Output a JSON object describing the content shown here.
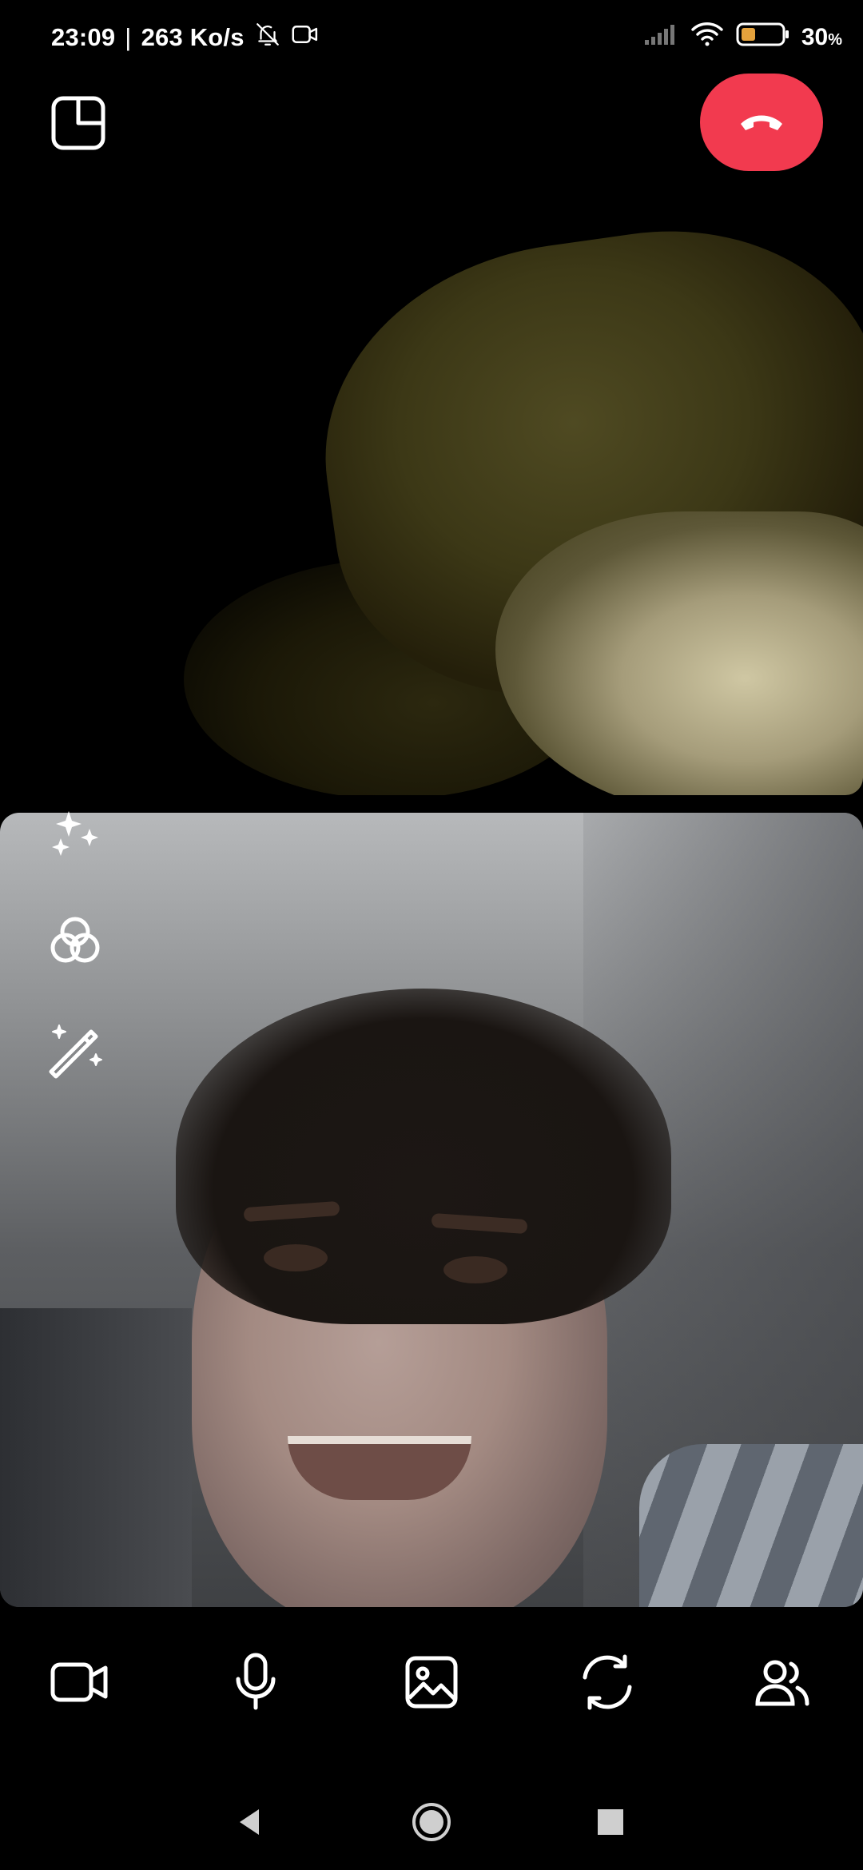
{
  "status_bar": {
    "time": "23:09",
    "separator": "|",
    "speed": "263 Ko/s",
    "battery_percent": "30",
    "battery_unit": "%",
    "icons": [
      "bell-off-icon",
      "video-camera-small-icon",
      "signal-icon",
      "wifi-icon",
      "battery-icon"
    ]
  },
  "call": {
    "top_controls": [
      "layout-icon",
      "end-call-icon"
    ],
    "end_call_color": "#f23a4f",
    "side_tools": [
      "sparkles-icon",
      "color-filter-icon",
      "magic-wand-icon"
    ],
    "bottom_controls": [
      "video-camera-icon",
      "microphone-icon",
      "gallery-icon",
      "switch-camera-icon",
      "participants-icon"
    ]
  },
  "nav_bar": {
    "buttons": [
      "back-icon",
      "home-icon",
      "recents-icon"
    ]
  }
}
